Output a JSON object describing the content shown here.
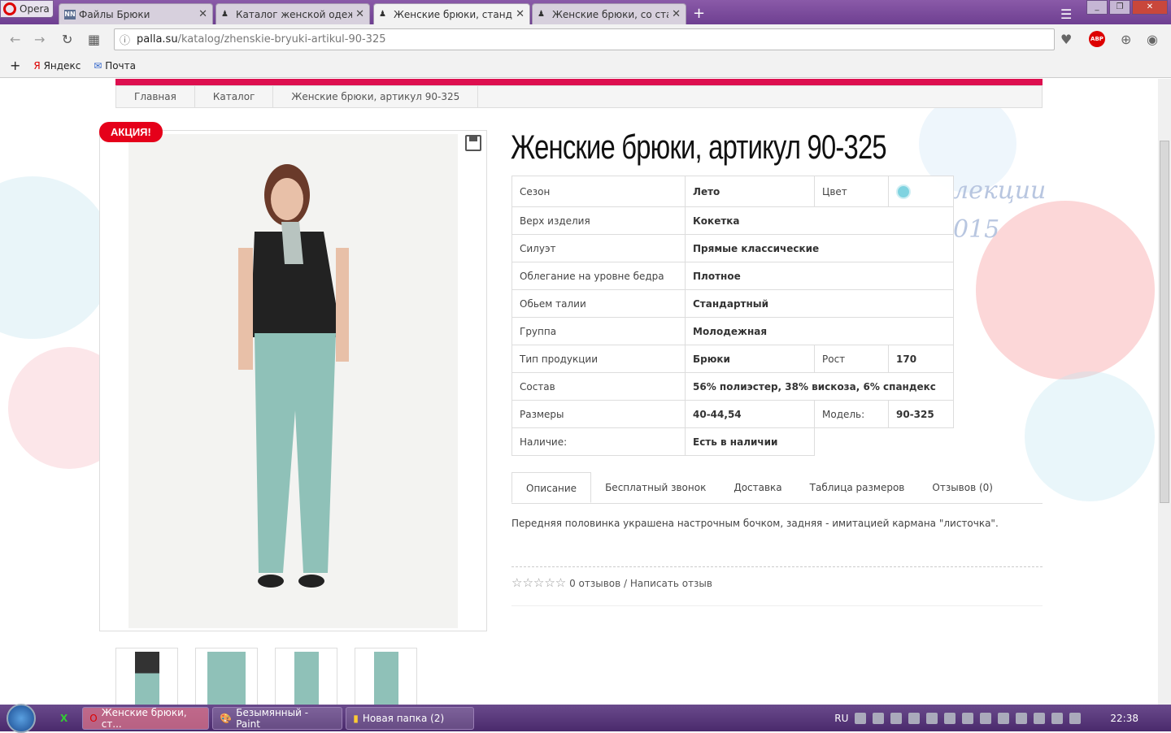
{
  "browser": {
    "opera_label": "Opera",
    "tabs": [
      {
        "title": "Файлы Брюки",
        "favicon": "NN"
      },
      {
        "title": "Каталог женской одежды"
      },
      {
        "title": "Женские брюки, стандарт"
      },
      {
        "title": "Женские брюки, со станд"
      }
    ],
    "url_domain": "palla.su",
    "url_path": "/katalog/zhenskie-bryuki-artikul-90-325",
    "abp": "ABP",
    "bookmarks": [
      {
        "label": "Яндекс",
        "icon": "Я"
      },
      {
        "label": "Почта"
      }
    ]
  },
  "breadcrumb": [
    "Главная",
    "Каталог",
    "Женские брюки, артикул 90-325"
  ],
  "badge": "АКЦИЯ!",
  "title": "Женские брюки, артикул 90-325",
  "bg_text": [
    "лекции",
    "015"
  ],
  "specs": {
    "season_l": "Сезон",
    "season": "Лето",
    "color_l": "Цвет",
    "color": "#7fd3e0",
    "rows": [
      {
        "l": "Верх изделия",
        "v": "Кокетка"
      },
      {
        "l": "Силуэт",
        "v": "Прямые классические"
      },
      {
        "l": "Облегание на уровне бедра",
        "v": "Плотное"
      },
      {
        "l": "Обьем талии",
        "v": "Стандартный"
      },
      {
        "l": "Группа",
        "v": "Молодежная"
      }
    ],
    "type_l": "Тип продукции",
    "type": "Брюки",
    "height_l": "Рост",
    "height": "170",
    "comp_l": "Состав",
    "comp": "56% полиэстер, 38% вискоза, 6% спандекс",
    "sizes_l": "Размеры",
    "sizes": "40-44,54",
    "model_l": "Модель:",
    "model": "90-325",
    "avail_l": "Наличие:",
    "avail": "Есть в наличии"
  },
  "tabs": [
    "Описание",
    "Бесплатный звонок",
    "Доставка",
    "Таблица размеров",
    "Отзывов (0)"
  ],
  "description": "Передняя половинка украшена настрочным бочком, задняя - имитацией кармана \"листочка\".",
  "reviews": {
    "text": "0 отзывов / Написать отзыв",
    "rating": 0
  },
  "taskbar": {
    "items": [
      "Женские брюки, ст...",
      "Безымянный - Paint",
      "Новая папка (2)"
    ],
    "lang": "RU",
    "time": "22:38"
  }
}
